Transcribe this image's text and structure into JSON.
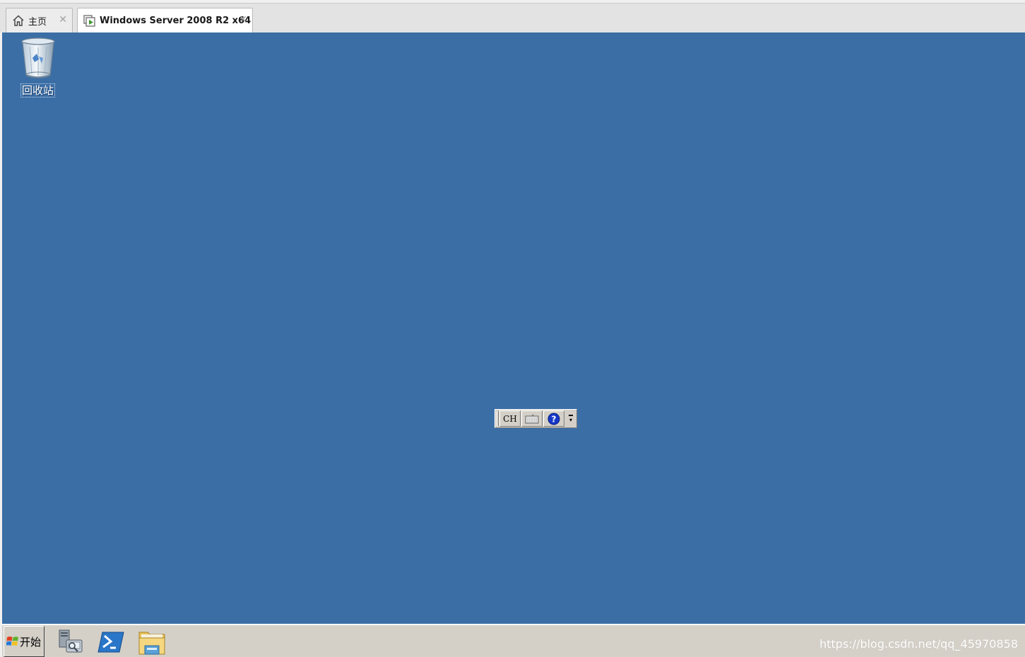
{
  "tabs": [
    {
      "label": "主页",
      "icon": "home-icon",
      "active": false
    },
    {
      "label": "Windows Server 2008 R2 x64",
      "icon": "vm-play-icon",
      "active": true
    }
  ],
  "tab_close_glyph": "✕",
  "desktop": {
    "background_color": "#3b6ea5",
    "recycle_bin_label": "回收站"
  },
  "language_bar": {
    "language_code": "CH",
    "buttons": [
      "keyboard-icon",
      "help-icon"
    ],
    "menu_glyph": "▾"
  },
  "taskbar": {
    "start_label": "开始",
    "pinned": [
      "server-manager-icon",
      "powershell-icon",
      "explorer-folder-icon"
    ],
    "watermark": "https://blog.csdn.net/qq_45970858"
  }
}
